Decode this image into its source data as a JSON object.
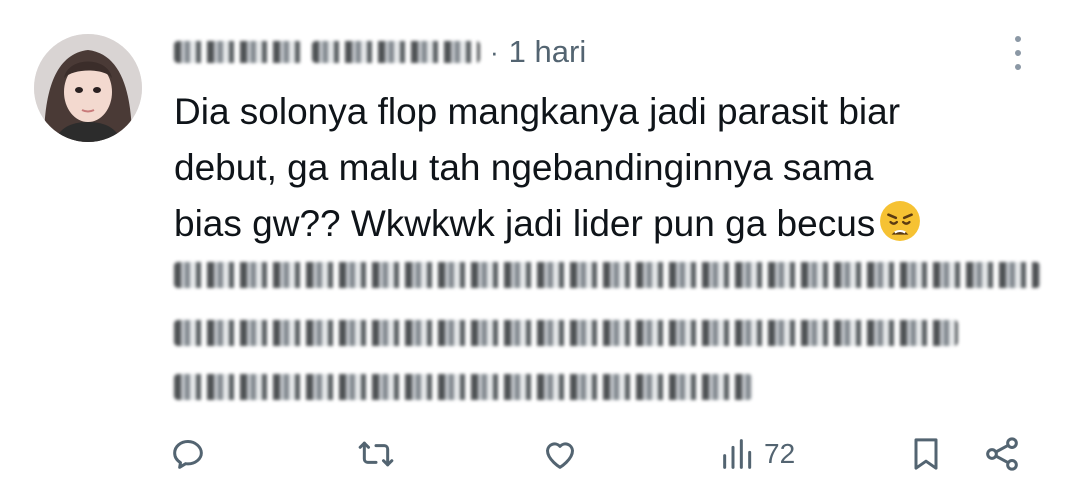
{
  "post": {
    "time_separator": "·",
    "timestamp": "1 hari",
    "text_lines": [
      "Dia solonya flop mangkanya jadi parasit biar",
      "debut, ga malu tah ngebandinginnya sama",
      "bias gw?? Wkwkwk jadi lider pun ga becus"
    ],
    "emoji": "weary-face"
  },
  "actions": {
    "reply_icon": "reply-icon",
    "repost_icon": "repost-icon",
    "like_icon": "heart-icon",
    "views_icon": "views-icon",
    "views_count": "72",
    "bookmark_icon": "bookmark-icon",
    "share_icon": "share-icon"
  },
  "colors": {
    "text": "#0f1419",
    "muted": "#536471",
    "background": "#ffffff",
    "emoji": "#f6c233"
  }
}
